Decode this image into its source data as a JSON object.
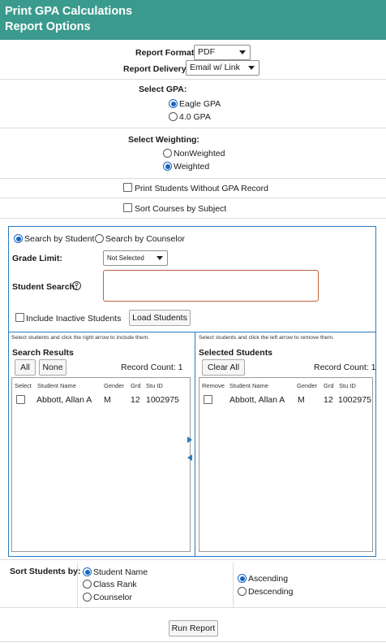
{
  "header": {
    "title_line1": "Print GPA Calculations",
    "title_line2": "Report Options"
  },
  "report": {
    "format_label": "Report Format:",
    "format_value": "PDF",
    "delivery_label": "Report Delivery:",
    "delivery_value": "Email w/ Link"
  },
  "gpa": {
    "label": "Select GPA:",
    "options": [
      "Eagle GPA",
      "4.0 GPA"
    ],
    "selected": "Eagle GPA"
  },
  "weighting": {
    "label": "Select Weighting:",
    "options": [
      "NonWeighted",
      "Weighted"
    ],
    "selected": "Weighted"
  },
  "checkboxes": {
    "print_without_gpa": "Print Students Without GPA Record",
    "sort_courses": "Sort Courses by Subject"
  },
  "search": {
    "by_student": "Search by Student",
    "by_counselor": "Search by Counselor",
    "grade_limit_label": "Grade Limit:",
    "grade_limit_value": "Not Selected",
    "student_search_label": "Student Search:",
    "help_icon": "?",
    "include_inactive": "Include Inactive Students",
    "load_button": "Load Students"
  },
  "left_list": {
    "hint": "Select students and click the right arrow to include them.",
    "title": "Search Results",
    "all_button": "All",
    "none_button": "None",
    "record_count": "Record Count: 1",
    "columns": [
      "Select",
      "Student Name",
      "Gender",
      "Grd",
      "Stu ID"
    ],
    "rows": [
      {
        "name": "Abbott, Allan A",
        "gender": "M",
        "grade": "12",
        "id": "1002975"
      }
    ]
  },
  "right_list": {
    "hint": "Select students and click the left arrow to remove them.",
    "title": "Selected Students",
    "clear_button": "Clear All",
    "record_count": "Record Count: 1",
    "columns": [
      "Remove",
      "Student Name",
      "Gender",
      "Grd",
      "Stu ID"
    ],
    "rows": [
      {
        "name": "Abbott, Allan A",
        "gender": "M",
        "grade": "12",
        "id": "1002975"
      }
    ]
  },
  "sort": {
    "label": "Sort Students by:",
    "field_options": [
      "Student Name",
      "Class Rank",
      "Counselor"
    ],
    "field_selected": "Student Name",
    "order_options": [
      "Ascending",
      "Descending"
    ],
    "order_selected": "Ascending"
  },
  "run_button": "Run Report",
  "colors": {
    "header_bg": "#3a9a8e",
    "panel_border": "#2b7bbf",
    "radio_selected": "#1565c0"
  }
}
